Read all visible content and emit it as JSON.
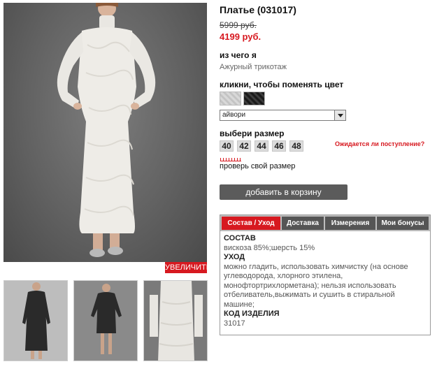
{
  "product": {
    "title": "Платье (031017)",
    "old_price": "5999 руб.",
    "new_price": "4199 руб."
  },
  "material": {
    "label": "из чего я",
    "value": "Ажурный трикотаж"
  },
  "color": {
    "label": "кликни, чтобы поменять цвет",
    "selected": "айвори",
    "swatches": [
      "light-lace-swatch",
      "black-lace-swatch"
    ]
  },
  "size": {
    "label": "выбери размер",
    "options": [
      "40",
      "42",
      "44",
      "46",
      "48"
    ],
    "expected_link": "Ожидается ли поступление?",
    "check_link": "проверь свой размер"
  },
  "actions": {
    "zoom": "УВЕЛИЧИТЬ",
    "add_to_cart": "добавить в корзину"
  },
  "tabs": {
    "items": [
      "Состав / Уход",
      "Доставка",
      "Измерения",
      "Мои бонусы"
    ],
    "active": "Состав / Уход",
    "content": {
      "composition_title": "СОСТАВ",
      "composition": "вискоза 85%;шерсть 15%",
      "care_title": "УХОД",
      "care": "можно гладить, использовать химчистку (на основе углеводорода, хлорного этилена, монофтортрихлорметана); нельзя использовать отбеливатель,выжимать и сушить в стиральной машине;",
      "code_title": "КОД ИЗДЕЛИЯ",
      "code": "31017"
    }
  },
  "colors": {
    "accent": "#d71920",
    "button": "#5b5b5b"
  }
}
